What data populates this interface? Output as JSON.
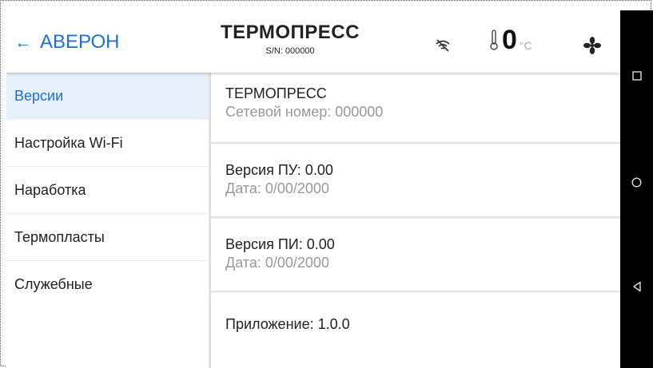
{
  "header": {
    "back_label": "АВЕРОН",
    "title": "ТЕРМОПРЕСС",
    "serial": "S/N: 000000",
    "temperature": "0",
    "temperature_unit": "°C",
    "icons": [
      "back-arrow-icon",
      "wifi-off-icon",
      "thermometer-icon",
      "fan-icon"
    ]
  },
  "sidebar": {
    "items": [
      {
        "label": "Версии",
        "active": true
      },
      {
        "label": "Настройка Wi-Fi"
      },
      {
        "label": "Наработка"
      },
      {
        "label": "Термопласты"
      },
      {
        "label": "Служебные"
      }
    ]
  },
  "content": {
    "device": {
      "name": "ТЕРМОПРЕСС",
      "network": "Сетевой номер: 000000"
    },
    "pu": {
      "version": "Версия ПУ: 0.00",
      "date": "Дата: 0/00/2000"
    },
    "pi": {
      "version": "Версия ПИ: 0.00",
      "date": "Дата: 0/00/2000"
    },
    "app": {
      "version": "Приложение: 1.0.0"
    }
  },
  "colors": {
    "accent": "#1f6fd0",
    "active_bg": "#e6f0fb",
    "content_bg": "#f1f1f1",
    "secondary_text": "#999999",
    "navbar": "#000000"
  },
  "android_nav": [
    "recent-apps-icon",
    "home-icon",
    "back-icon"
  ]
}
